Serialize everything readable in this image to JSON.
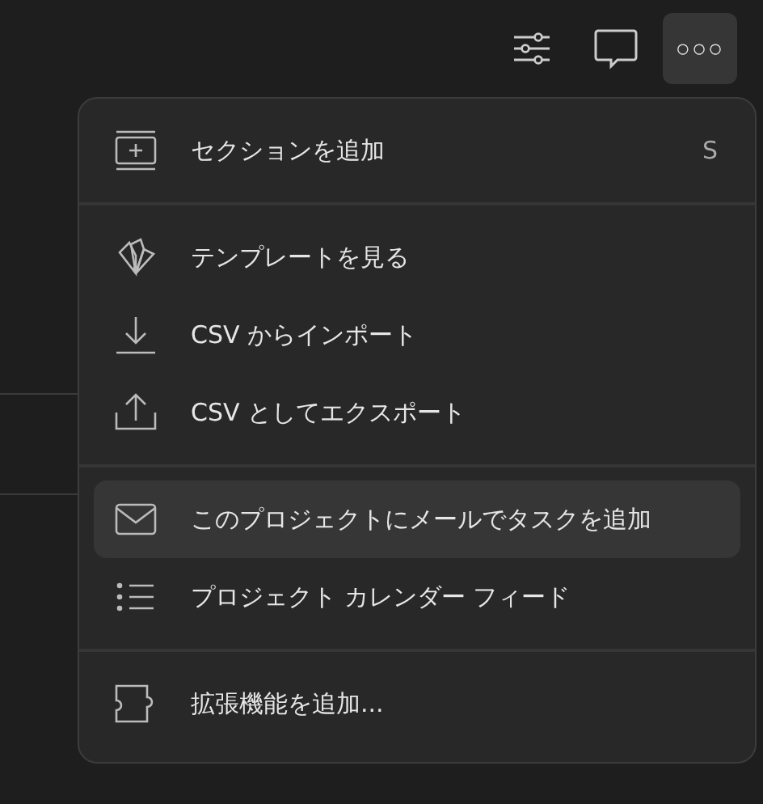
{
  "toolbar": [
    {
      "selected": false
    },
    {
      "selected": false
    },
    {
      "label": "○○○",
      "selected": true
    }
  ],
  "menu": {
    "sections": [
      {
        "items": [
          {
            "label": "セクションを追加",
            "shortcut": "S",
            "selected": false
          }
        ]
      },
      {
        "items": [
          {
            "label": "テンプレートを見る",
            "selected": false
          },
          {
            "label": "CSV からインポート",
            "selected": false
          },
          {
            "label": "CSV としてエクスポート",
            "selected": false
          }
        ]
      },
      {
        "items": [
          {
            "label": "このプロジェクトにメールでタスクを追加",
            "selected": true
          },
          {
            "label": "プロジェクト カレンダー フィード",
            "selected": false
          }
        ]
      },
      {
        "items": [
          {
            "label": "拡張機能を追加...",
            "selected": false
          }
        ]
      }
    ]
  }
}
